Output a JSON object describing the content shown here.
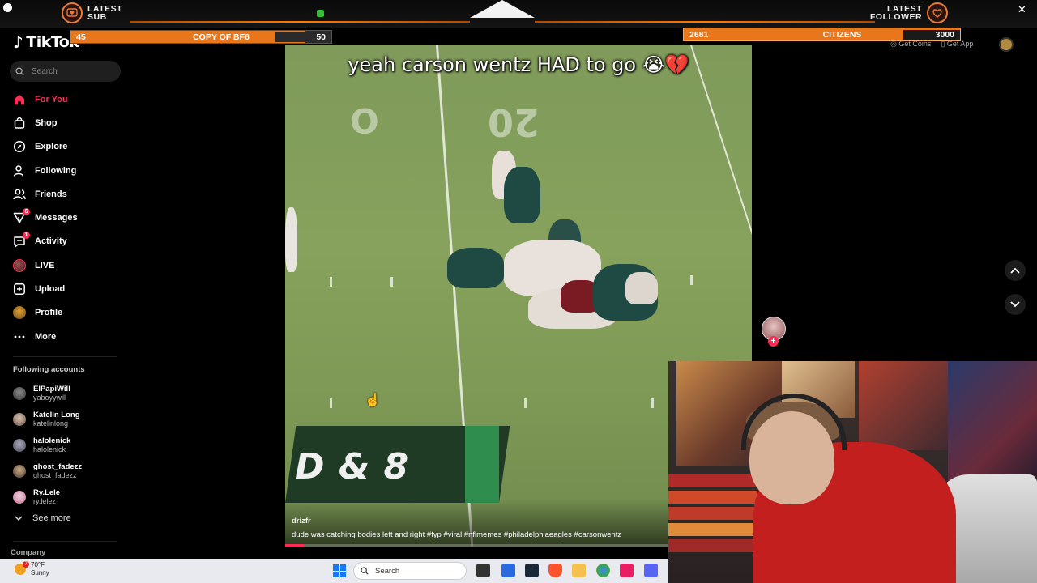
{
  "app": {
    "name": "TikTok"
  },
  "search": {
    "placeholder": "Search"
  },
  "nav": {
    "items": [
      {
        "label": "For You",
        "icon": "home-icon"
      },
      {
        "label": "Shop",
        "icon": "shop-icon"
      },
      {
        "label": "Explore",
        "icon": "compass-icon"
      },
      {
        "label": "Following",
        "icon": "following-icon"
      },
      {
        "label": "Friends",
        "icon": "friends-icon"
      },
      {
        "label": "Messages",
        "icon": "messages-icon",
        "badge": "6"
      },
      {
        "label": "Activity",
        "icon": "activity-icon",
        "badge": "1"
      },
      {
        "label": "LIVE",
        "icon": "live-icon"
      },
      {
        "label": "Upload",
        "icon": "upload-icon"
      },
      {
        "label": "Profile",
        "icon": "profile-icon"
      },
      {
        "label": "More",
        "icon": "more-icon"
      }
    ]
  },
  "following": {
    "title": "Following accounts",
    "accounts": [
      {
        "name": "ElPapiWill",
        "handle": "yaboyywill"
      },
      {
        "name": "Katelin Long",
        "handle": "katelinlong"
      },
      {
        "name": "halolenick",
        "handle": "halolenick"
      },
      {
        "name": "ghost_fadezz",
        "handle": "ghost_fadezz"
      },
      {
        "name": "Ry.Lele",
        "handle": "ry.lelez"
      }
    ],
    "see_more": "See more"
  },
  "footer": {
    "company": "Company"
  },
  "overlay": {
    "latest_sub_line1": "LATEST",
    "latest_sub_line2": "SUB",
    "latest_follower_line1": "LATEST",
    "latest_follower_line2": "FOLLOWER",
    "goal_left": {
      "current": "45",
      "title": "COPY OF BF6",
      "target": "50",
      "progress": 0.9
    },
    "goal_right": {
      "current": "2681",
      "title": "CITIZENS",
      "target": "3000",
      "progress": 0.89
    },
    "accent": "#e8761a"
  },
  "header_right": {
    "get_coins": "Get Coins",
    "get_app": "Get App"
  },
  "video": {
    "caption": "yeah carson wentz HAD to go 😭💔",
    "field_number": "20",
    "score_text": "D & 8",
    "author": "drizfr",
    "description": "dude was catching bodies left and right #fyp  #viral  #nflmemes  #philadelphiaeagles  #carsonwentz",
    "progress": 0.04
  },
  "taskbar": {
    "temperature": "70°F",
    "condition": "Sunny",
    "weather_badge": "7",
    "search_placeholder": "Search"
  },
  "colors": {
    "tiktok_red": "#fe2c55",
    "sidebar_bg": "#000000"
  }
}
